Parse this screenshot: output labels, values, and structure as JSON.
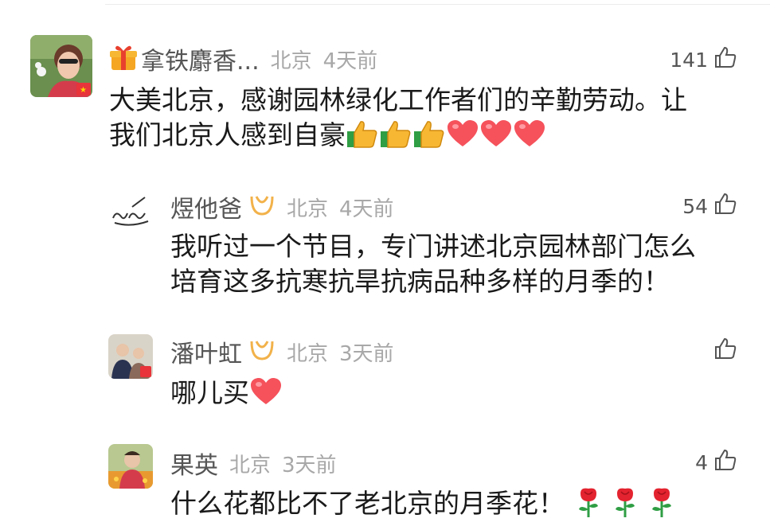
{
  "comments": [
    {
      "username": "拿铁麝香...",
      "location": "北京",
      "time": "4天前",
      "likes": "141",
      "lines": [
        "大美北京，感谢园林绿化工作者们的辛勤劳动。让",
        "我们北京人感到自豪"
      ],
      "emojis": [
        "thumbs-up",
        "thumbs-up",
        "thumbs-up",
        "heart",
        "heart",
        "heart"
      ]
    },
    {
      "username": "煜他爸",
      "location": "北京",
      "time": "4天前",
      "likes": "54",
      "lines": [
        "我听过一个节目，专门讲述北京园林部门怎么",
        "培育这多抗寒抗旱抗病品种多样的月季的！"
      ]
    },
    {
      "username": "潘叶虹",
      "location": "北京",
      "time": "3天前",
      "likes": "",
      "lines": [
        "哪儿买"
      ],
      "emojis": [
        "heart"
      ]
    },
    {
      "username": "果英",
      "location": "北京",
      "time": "3天前",
      "likes": "4",
      "lines": [
        "什么花都比不了老北京的月季花！"
      ],
      "emojis": [
        "rose",
        "rose",
        "rose"
      ]
    }
  ],
  "colors": {
    "text": "#1a1a1a",
    "username": "#555555",
    "meta": "#a8a8a8",
    "heart": "#f5525c",
    "badge": "#f2b24a"
  }
}
